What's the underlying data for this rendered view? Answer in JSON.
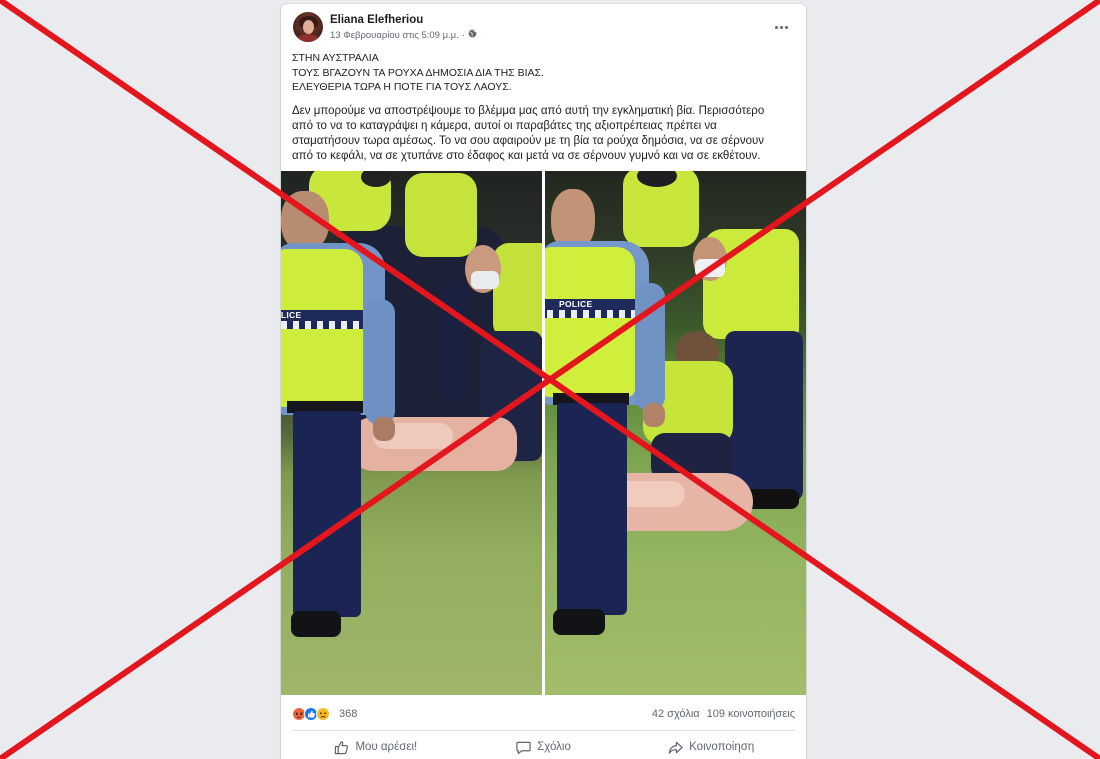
{
  "post": {
    "author_name": "Eliana Elefheriou",
    "timestamp": "13 Φεβρουαρίου στις 5:09 μ.μ.",
    "separator": "·",
    "headline_lines": [
      "ΣΤΗΝ ΑΥΣΤΡΑΛΙΑ",
      "ΤΟΥΣ ΒΓΑΖΟΥΝ ΤΑ ΡΟΥΧΑ ΔΗΜΟΣΙΑ ΔΙΑ ΤΗΣ ΒΙΑΣ.",
      "ΕΛΕΥΘΕΡΙΑ ΤΩΡΑ Η ΠΟΤΕ ΓΙΑ ΤΟΥΣ ΛΑΟΥΣ."
    ],
    "body_lines": [
      "Δεν μπορούμε να αποστρέψουμε το βλέμμα μας από αυτή την εγκληματική βία. Περισσότερο",
      "από το να το καταγράψει η κάμερα, αυτοί οι παραβάτες της αξιοπρέπειας πρέπει να",
      "σταματήσουν τωρα αμέσως. Το να σου αφαιρούν με τη βία τα ρούχα δημόσια, να σε σέρνουν",
      "από το κεφάλι, να σε χτυπάνε στο έδαφος και μετά να σε σέρνουν γυμνό και να σε εκθέτουν."
    ],
    "photo": {
      "vest_label": "POLICE"
    }
  },
  "engagement": {
    "reaction_icons": [
      "angry-icon",
      "like-icon",
      "sad-icon"
    ],
    "reaction_count": "368",
    "comments": "42 σχόλια",
    "shares": "109 κοινοποιήσεις"
  },
  "actions": {
    "like_label": "Μου αρέσει!",
    "comment_label": "Σχόλιο",
    "share_label": "Κοινοποίηση"
  },
  "icons": {
    "privacy": "globe-icon",
    "more": "more-options-icon",
    "like": "thumbs-up-icon",
    "comment": "comment-icon",
    "share": "share-icon"
  },
  "colors": {
    "page_background": "#e9ebee",
    "card_background": "#ffffff",
    "text_primary": "#1c1e21",
    "text_secondary": "#606770",
    "cross": "#e3151d",
    "reaction_angry": "#f0663c",
    "reaction_like": "#1877f2",
    "reaction_sad": "#f7b928"
  }
}
